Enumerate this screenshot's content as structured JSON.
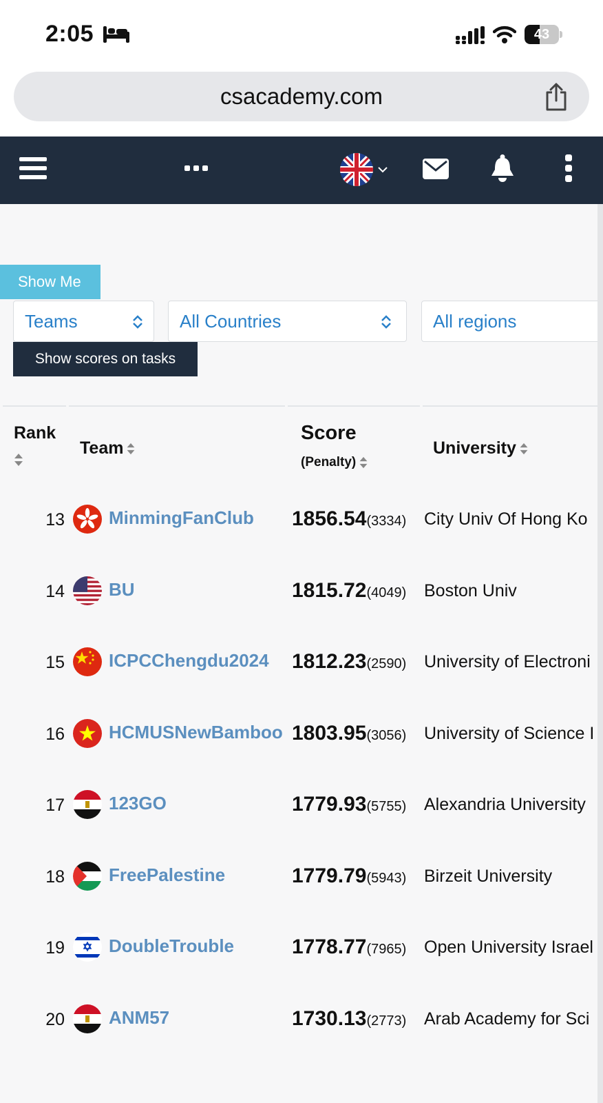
{
  "status_bar": {
    "time": "2:05",
    "battery": "43",
    "battery_level": 0.43
  },
  "browser": {
    "url": "csacademy.com"
  },
  "filters": {
    "show_me_label": "Show Me",
    "type_select": "Teams",
    "country_select": "All Countries",
    "region_select": "All regions",
    "show_scores_label": "Show scores on tasks"
  },
  "table": {
    "headers": {
      "rank": "Rank",
      "team": "Team",
      "score": "Score",
      "penalty": "(Penalty)",
      "university": "University"
    },
    "rows": [
      {
        "rank": "13",
        "flag": "hong-kong",
        "team": "MinmingFanClub",
        "score": "1856.54",
        "penalty": "(3334)",
        "university": "City Univ Of Hong Ko"
      },
      {
        "rank": "14",
        "flag": "united-states",
        "team": "BU",
        "score": "1815.72",
        "penalty": "(4049)",
        "university": "Boston Univ"
      },
      {
        "rank": "15",
        "flag": "china",
        "team": "ICPCChengdu2024",
        "score": "1812.23",
        "penalty": "(2590)",
        "university": "University of Electroni"
      },
      {
        "rank": "16",
        "flag": "vietnam",
        "team": "HCMUSNewBamboo",
        "score": "1803.95",
        "penalty": "(3056)",
        "university": "University of Science I"
      },
      {
        "rank": "17",
        "flag": "egypt",
        "team": "123GO",
        "score": "1779.93",
        "penalty": "(5755)",
        "university": "Alexandria University"
      },
      {
        "rank": "18",
        "flag": "palestine",
        "team": "FreePalestine",
        "score": "1779.79",
        "penalty": "(5943)",
        "university": "Birzeit University"
      },
      {
        "rank": "19",
        "flag": "israel",
        "team": "DoubleTrouble",
        "score": "1778.77",
        "penalty": "(7965)",
        "university": "Open University Israel"
      },
      {
        "rank": "20",
        "flag": "egypt",
        "team": "ANM57",
        "score": "1730.13",
        "penalty": "(2773)",
        "university": "Arab Academy for Sci"
      }
    ]
  },
  "colors": {
    "navbar": "#202d3e",
    "link": "#5b8fbf",
    "accent": "#5bc0de",
    "select_text": "#2980c9"
  }
}
